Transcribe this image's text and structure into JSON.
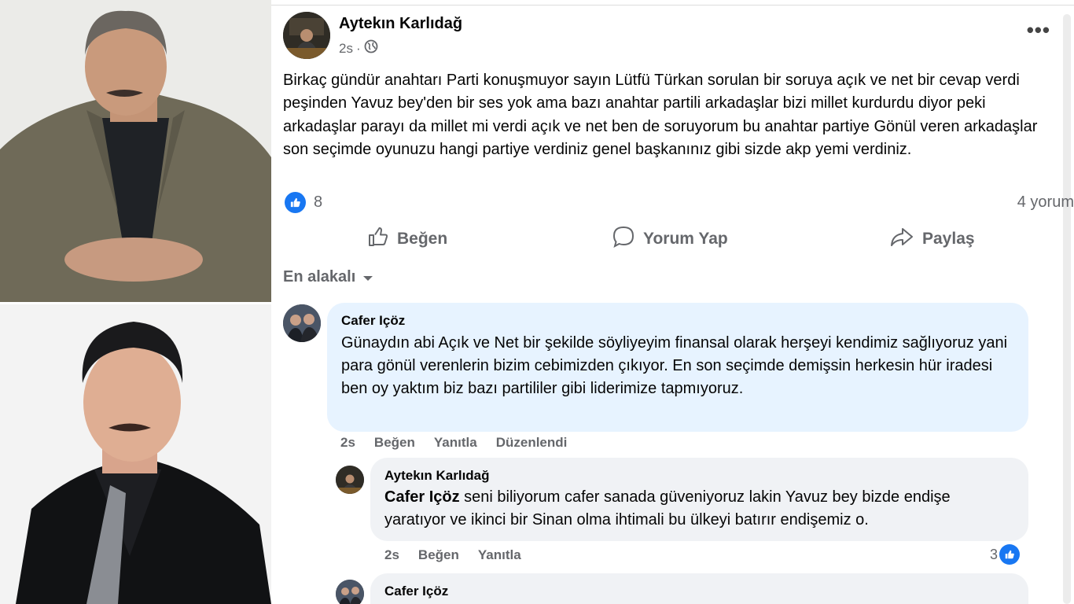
{
  "post": {
    "author": "Aytekın Karlıdağ",
    "time": "2s",
    "separator": "·",
    "text": "Birkaç gündür anahtarı Parti konuşmuyor sayın Lütfü Türkan sorulan bir soruya açık ve net bir cevap verdi peşinden Yavuz bey'den bir ses yok ama bazı anahtar partili arkadaşlar bizi millet kurdurdu diyor peki arkadaşlar parayı da millet mi verdi açık ve net ben de soruyorum bu anahtar partiye Gönül veren arkadaşlar son seçimde oyunuzu hangi partiye verdiniz genel başkanınız gibi sizde akp yemi verdiniz.",
    "like_count": "8",
    "comment_count": "4 yorum"
  },
  "actions": {
    "like": "Beğen",
    "comment": "Yorum Yap",
    "share": "Paylaş"
  },
  "sort_label": "En alakalı",
  "comments": [
    {
      "author": "Cafer Içöz",
      "text": "Günaydın abi Açık ve Net bir şekilde söyliyeyim finansal olarak herşeyi kendimiz sağlıyoruz yani para gönül verenlerin bizim cebimizden çıkıyor. En son seçimde demişsin herkesin hür iradesi ben oy yaktım biz bazı partililer gibi liderimize tapmıyoruz.",
      "time": "2s",
      "like": "Beğen",
      "reply": "Yanıtla",
      "edited": "Düzenlendi"
    },
    {
      "author": "Aytekın Karlıdağ",
      "mention": "Cafer Içöz",
      "text": " seni biliyorum cafer sanada güveniyoruz lakin Yavuz bey bizde endişe yaratıyor ve ikinci bir Sinan olma ihtimali bu ülkeyi batırır endişemiz o.",
      "time": "2s",
      "like": "Beğen",
      "reply": "Yanıtla",
      "likes": "3"
    },
    {
      "author": "Cafer Içöz"
    }
  ],
  "colors": {
    "accent": "#1877f2",
    "secondary_text": "#65676b",
    "comment_bg": "#f0f2f5",
    "highlighted_comment_bg": "#e7f3ff"
  },
  "icons": [
    "globe-icon",
    "more-options-icon",
    "like-reaction-icon",
    "thumbs-up-icon",
    "comment-icon",
    "share-icon",
    "caret-down-icon"
  ]
}
